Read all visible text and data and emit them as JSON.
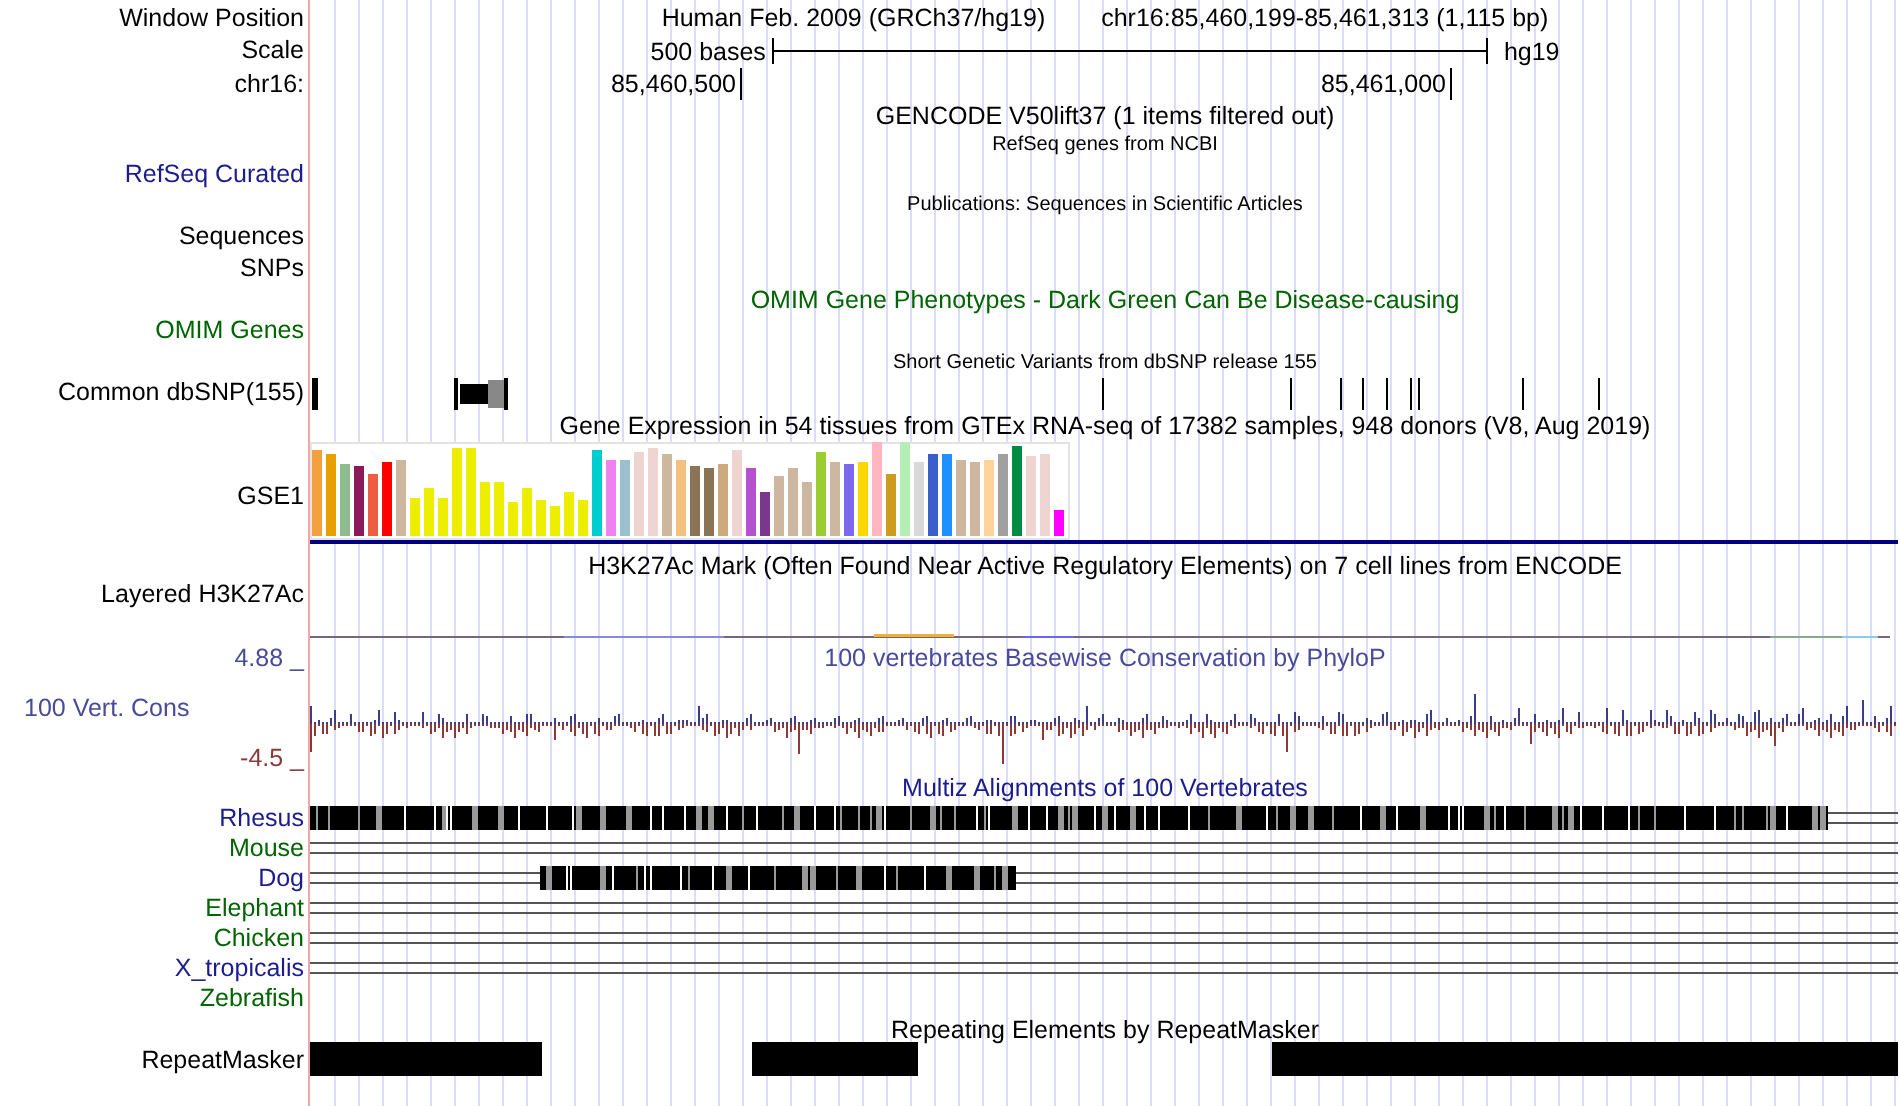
{
  "header": {
    "label": "Window Position",
    "assembly": "Human Feb. 2009 (GRCh37/hg19)",
    "position": "chr16:85,460,199-85,461,313 (1,115 bp)"
  },
  "scale": {
    "label": "Scale",
    "span": "500 bases",
    "db": "hg19"
  },
  "coordinates": {
    "label": "chr16:",
    "ticks": [
      "85,460,500",
      "85,461,000"
    ]
  },
  "tracks": [
    {
      "kind": "gencode",
      "title": "GENCODE V50lift37 (1 items filtered out)",
      "color": "#000000"
    },
    {
      "kind": "refseq",
      "title": "RefSeq genes from NCBI",
      "color": "#000000",
      "labels": [
        {
          "text": "RefSeq Curated",
          "color": "#1c1c8c"
        }
      ]
    },
    {
      "kind": "pubs",
      "title": "Publications: Sequences in Scientific Articles",
      "color": "#000000",
      "labels": [
        {
          "text": "Sequences",
          "color": "#000000"
        },
        {
          "text": "SNPs",
          "color": "#000000"
        }
      ]
    },
    {
      "kind": "omim",
      "title": "OMIM Gene Phenotypes - Dark Green Can Be Disease-causing",
      "color": "#006400",
      "labels": [
        {
          "text": "OMIM Genes",
          "color": "#006400"
        }
      ]
    },
    {
      "kind": "dbsnp",
      "title": "Short Genetic Variants from dbSNP release 155",
      "color": "#000000",
      "labels": [
        {
          "text": "Common dbSNP(155)",
          "color": "#000000"
        }
      ]
    },
    {
      "kind": "gtex",
      "title": "Gene Expression in 54 tissues from GTEx RNA-seq of 17382 samples, 948 donors (V8, Aug 2019)",
      "color": "#000000",
      "labels": [
        {
          "text": "GSE1",
          "color": "#000000"
        }
      ]
    },
    {
      "kind": "h3k27ac",
      "title": "H3K27Ac Mark (Often Found Near Active Regulatory Elements) on 7 cell lines from ENCODE",
      "color": "#000000",
      "labels": [
        {
          "text": "Layered H3K27Ac",
          "color": "#000000"
        }
      ]
    },
    {
      "kind": "phylop",
      "title": "100 vertebrates Basewise Conservation by PhyloP",
      "color": "#4a4a9a",
      "labels": [
        {
          "text": "4.88 _",
          "color": "#4a4a9a"
        },
        {
          "text": "100 Vert. Cons",
          "color": "#4a4a9a"
        },
        {
          "text": "-4.5 _",
          "color": "#8b3a3a"
        }
      ]
    },
    {
      "kind": "multiz",
      "title": "Multiz Alignments of 100 Vertebrates",
      "color": "#1c1c8c",
      "species": [
        {
          "name": "Rhesus",
          "color": "#1c1c8c",
          "kind": "full"
        },
        {
          "name": "Mouse",
          "color": "#006400",
          "kind": "lines"
        },
        {
          "name": "Dog",
          "color": "#1c1c8c",
          "kind": "partial"
        },
        {
          "name": "Elephant",
          "color": "#006400",
          "kind": "lines"
        },
        {
          "name": "Chicken",
          "color": "#006400",
          "kind": "lines"
        },
        {
          "name": "X_tropicalis",
          "color": "#1c1c8c",
          "kind": "lines"
        },
        {
          "name": "Zebrafish",
          "color": "#006400",
          "kind": "none"
        }
      ]
    },
    {
      "kind": "rmsk",
      "title": "Repeating Elements by RepeatMasker",
      "color": "#000000",
      "labels": [
        {
          "text": "RepeatMasker",
          "color": "#000000"
        }
      ]
    }
  ]
}
